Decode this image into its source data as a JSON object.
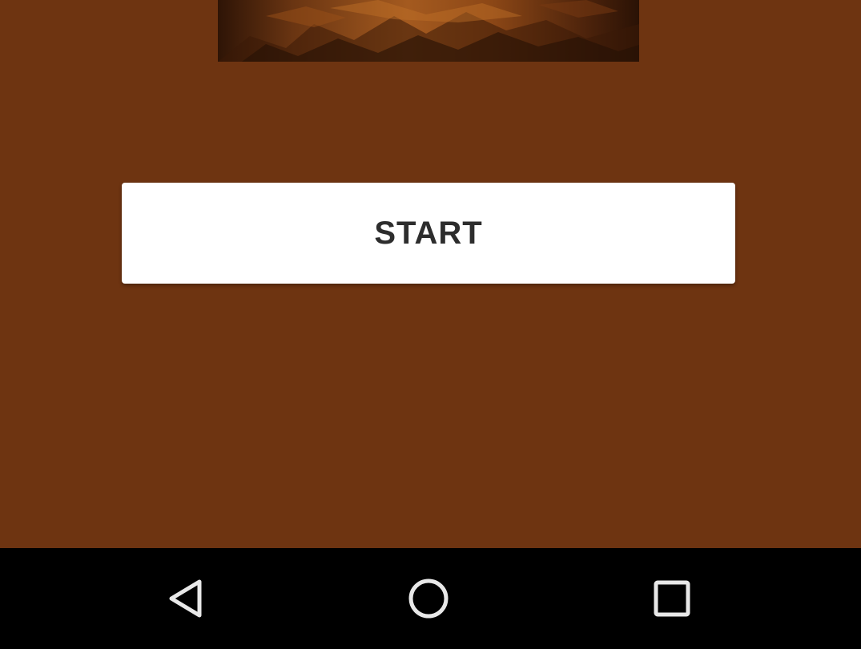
{
  "main": {
    "start_label": "START"
  },
  "navigation": {
    "back_icon": "back-triangle-icon",
    "home_icon": "home-circle-icon",
    "recents_icon": "recents-square-icon"
  },
  "colors": {
    "background": "#6e3411",
    "button": "#ffffff",
    "button_text": "#2d2d2d",
    "nav_bar": "#000000",
    "nav_icons": "#e8e8e8"
  }
}
